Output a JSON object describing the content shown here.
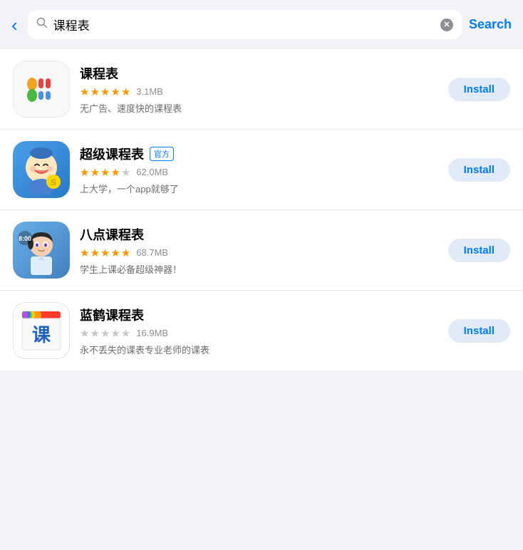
{
  "topbar": {
    "back_label": "‹",
    "search_query": "课程表",
    "search_placeholder": "课程表",
    "search_button_label": "Search"
  },
  "apps": [
    {
      "name": "课程表",
      "official": false,
      "rating_full": 4,
      "rating_half": true,
      "rating_empty": 0,
      "rating_total": 5,
      "file_size": "3.1MB",
      "description": "无广告、速度快的课程表",
      "install_label": "Install",
      "icon_id": "kechengbiao"
    },
    {
      "name": "超级课程表",
      "official": true,
      "official_label": "官方",
      "rating_full": 4,
      "rating_half": false,
      "rating_empty": 1,
      "rating_total": 5,
      "file_size": "62.0MB",
      "description": "上大学，一个app就够了",
      "install_label": "Install",
      "icon_id": "super"
    },
    {
      "name": "八点课程表",
      "official": false,
      "rating_full": 5,
      "rating_half": false,
      "rating_empty": 0,
      "rating_total": 5,
      "file_size": "68.7MB",
      "description": "学生上课必备超级神器！",
      "install_label": "Install",
      "icon_id": "badian"
    },
    {
      "name": "蓝鹤课程表",
      "official": false,
      "rating_full": 0,
      "rating_half": false,
      "rating_empty": 5,
      "rating_total": 5,
      "file_size": "16.9MB",
      "description": "永不丢失的课表专业老师的课表",
      "install_label": "Install",
      "icon_id": "lanhe"
    }
  ]
}
